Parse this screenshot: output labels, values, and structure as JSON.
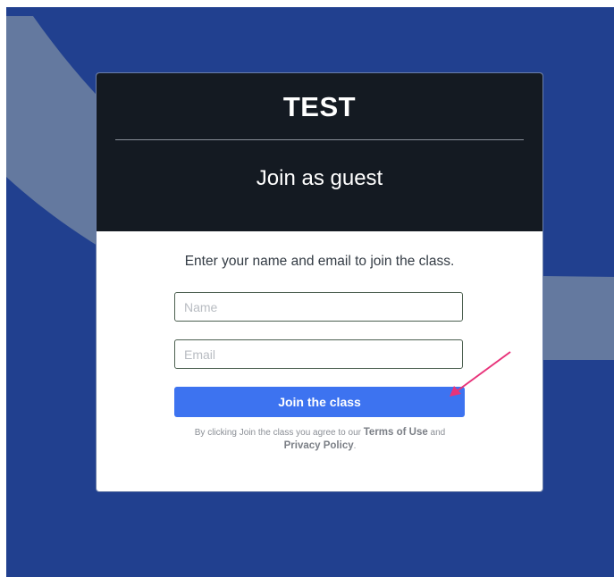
{
  "colors": {
    "page_background": "#21408f",
    "swoosh": "#64799f",
    "header_background": "#141a22",
    "button_background": "#3d73f0",
    "annotation_arrow": "#e8337a"
  },
  "card": {
    "brand": "TEST",
    "title": "Join as guest",
    "intro": "Enter your name and email to join the class.",
    "name_field": {
      "placeholder": "Name",
      "value": ""
    },
    "email_field": {
      "placeholder": "Email",
      "value": ""
    },
    "join_button_label": "Join the class",
    "terms": {
      "prefix": "By clicking Join the class you agree to our",
      "terms_link": "Terms of Use",
      "conjunction": "and",
      "privacy_link": "Privacy Policy",
      "suffix": "."
    }
  },
  "annotation": {
    "icon": "arrow-icon"
  }
}
